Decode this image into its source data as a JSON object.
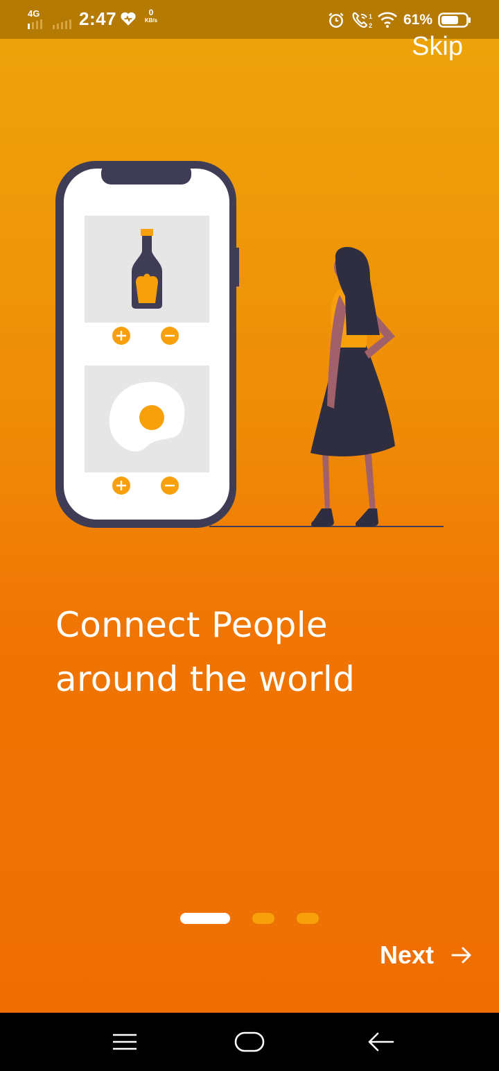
{
  "status_bar": {
    "network_type": "4G",
    "time": "2:47",
    "speed_value": "0",
    "speed_unit": "KB/s",
    "battery_percent": "61%",
    "icons": [
      "signal-icon",
      "heart-icon",
      "alarm-icon",
      "wifi-call-icon",
      "wifi-icon",
      "battery-icon"
    ]
  },
  "onboarding": {
    "skip_label": "Skip",
    "headline_line1": "Connect People",
    "headline_line2": "around the world",
    "next_label": "Next",
    "page_count": 3,
    "active_page": 1
  },
  "illustration": {
    "description_icons": [
      "phone-illustration",
      "bottle-icon",
      "fried-egg-icon",
      "plus-icon",
      "minus-icon",
      "woman-figure"
    ]
  },
  "colors": {
    "gradient_top": "#eea50b",
    "gradient_bottom": "#ef6e03",
    "status_bar": "#b57a03",
    "accent_orange": "#f8a00b",
    "phone_dark": "#3f3d56"
  },
  "nav_bar": {
    "icons": [
      "menu-icon",
      "home-icon",
      "back-icon"
    ]
  }
}
